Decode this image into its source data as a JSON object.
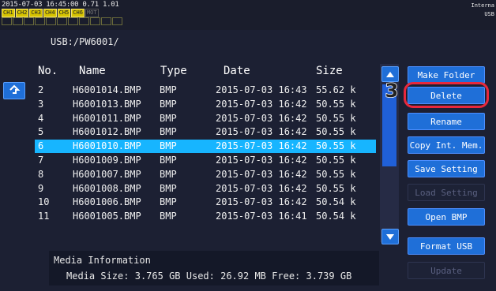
{
  "status": {
    "datetime": "2015-07-03 16:45:00 0.71 1.01",
    "channels": [
      "CH1",
      "CH2",
      "CH3",
      "CH4",
      "CH5",
      "CH6"
    ],
    "channel_extra": "MOT",
    "storage_top": "Interna",
    "storage_bottom": "USB"
  },
  "path": "USB:/PW6001/",
  "columns": {
    "no": "No.",
    "name": "Name",
    "type": "Type",
    "date": "Date",
    "size": "Size"
  },
  "files": [
    {
      "no": "2",
      "name": "H6001014.BMP",
      "type": "BMP",
      "date": "2015-07-03 16:43",
      "size": "55.62 k"
    },
    {
      "no": "3",
      "name": "H6001013.BMP",
      "type": "BMP",
      "date": "2015-07-03 16:42",
      "size": "50.55 k"
    },
    {
      "no": "4",
      "name": "H6001011.BMP",
      "type": "BMP",
      "date": "2015-07-03 16:42",
      "size": "50.55 k"
    },
    {
      "no": "5",
      "name": "H6001012.BMP",
      "type": "BMP",
      "date": "2015-07-03 16:42",
      "size": "50.55 k"
    },
    {
      "no": "6",
      "name": "H6001010.BMP",
      "type": "BMP",
      "date": "2015-07-03 16:42",
      "size": "50.55 k"
    },
    {
      "no": "7",
      "name": "H6001009.BMP",
      "type": "BMP",
      "date": "2015-07-03 16:42",
      "size": "50.55 k"
    },
    {
      "no": "8",
      "name": "H6001007.BMP",
      "type": "BMP",
      "date": "2015-07-03 16:42",
      "size": "50.55 k"
    },
    {
      "no": "9",
      "name": "H6001008.BMP",
      "type": "BMP",
      "date": "2015-07-03 16:42",
      "size": "50.55 k"
    },
    {
      "no": "10",
      "name": "H6001006.BMP",
      "type": "BMP",
      "date": "2015-07-03 16:42",
      "size": "50.54 k"
    },
    {
      "no": "11",
      "name": "H6001005.BMP",
      "type": "BMP",
      "date": "2015-07-03 16:41",
      "size": "50.54 k"
    }
  ],
  "selected_no": "6",
  "buttons": {
    "make_folder": "Make Folder",
    "delete": "Delete",
    "rename": "Rename",
    "copy_int": "Copy Int. Mem.",
    "save_setting": "Save Setting",
    "load_setting": "Load Setting",
    "open_bmp": "Open BMP",
    "format_usb": "Format USB",
    "update": "Update"
  },
  "step_badge": "3",
  "media": {
    "title": "Media Information",
    "size_label": "Media Size:",
    "size_value": "3.765 GB",
    "used_label": "Used:",
    "used_value": "26.92 MB",
    "free_label": "Free:",
    "free_value": "3.739 GB"
  },
  "colors": {
    "accent": "#1f6fd8",
    "selection": "#17b5ff",
    "highlight": "#e8283c",
    "channel": "#d7c400"
  }
}
